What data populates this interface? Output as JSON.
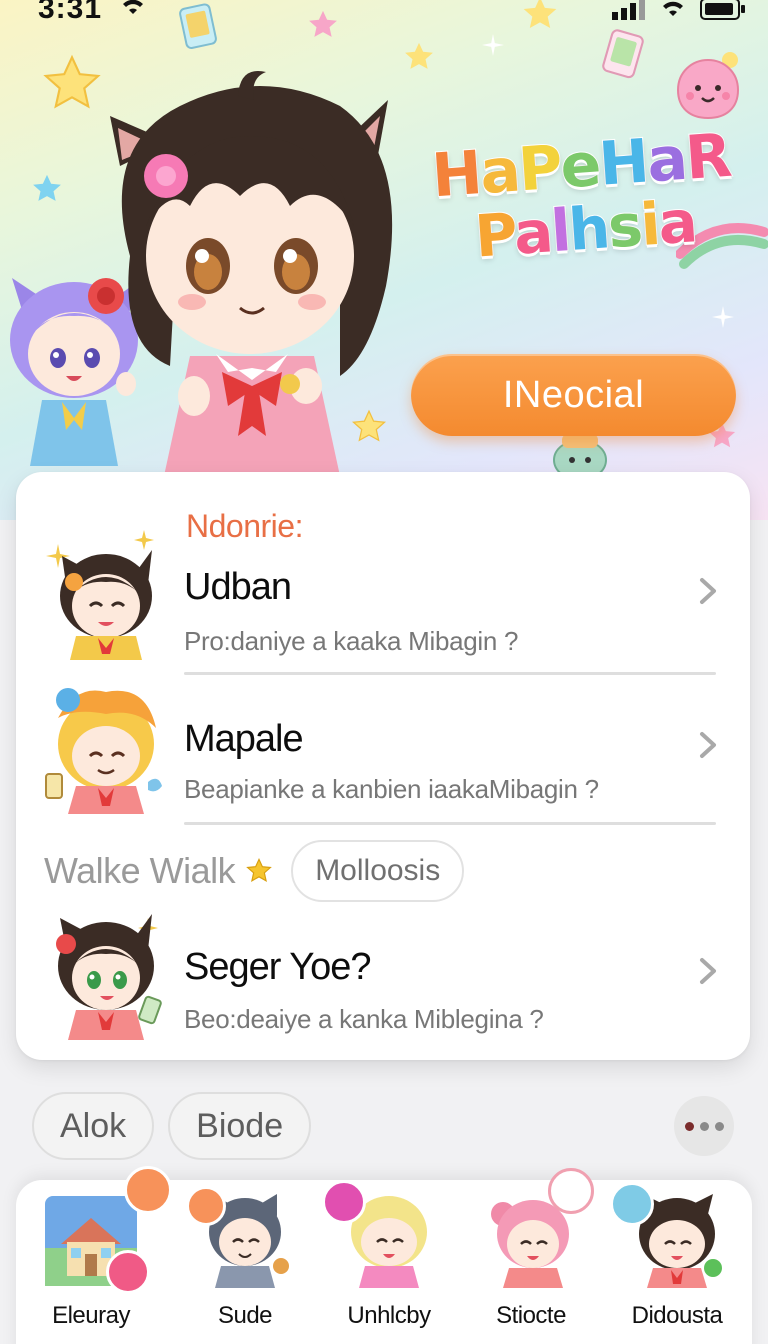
{
  "status_bar": {
    "time": "3:31"
  },
  "hero": {
    "title_line1": "HaPeHaR",
    "title_line2": "Palhsia",
    "cta_label": "INeocial"
  },
  "list": {
    "section_title": "Ndonrie:",
    "items": [
      {
        "title": "Udban",
        "subtitle": "Pro:daniye a kaaka Mibagin ?"
      },
      {
        "title": "Mapale",
        "subtitle": "Beapianke a kanbien iaakaMibagin ?"
      },
      {
        "title": "Seger Yoe?",
        "subtitle": "Beo:deaiye a kanka Miblegina ?"
      }
    ],
    "subsection_title": "Walke Wialk",
    "subsection_chip": "Molloosis"
  },
  "filters": {
    "chips": [
      "Alok",
      "Biode"
    ]
  },
  "dock": {
    "items": [
      {
        "label": "Eleuray"
      },
      {
        "label": "Sude"
      },
      {
        "label": "Unhlcby"
      },
      {
        "label": "Stiocte"
      },
      {
        "label": "Didousta"
      }
    ]
  },
  "colors": {
    "accent_orange": "#f48a2f",
    "section_title": "#e86f45",
    "card_background": "#ffffff",
    "page_background": "#f1f1f3"
  },
  "icons": [
    "wifi-icon",
    "signal-icon",
    "battery-icon",
    "chevron-right-icon",
    "star-icon",
    "more-dots-icon"
  ]
}
